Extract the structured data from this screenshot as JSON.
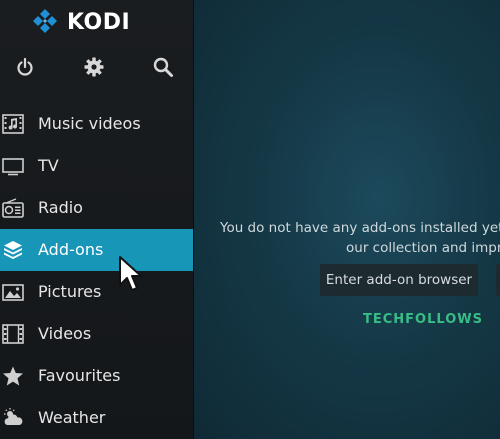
{
  "app": {
    "name": "KODI"
  },
  "top_icons": [
    {
      "icon": "power-icon"
    },
    {
      "icon": "gear-icon"
    },
    {
      "icon": "search-icon"
    }
  ],
  "menu": {
    "items": [
      {
        "label": "Music videos",
        "icon": "music-video-icon",
        "active": false
      },
      {
        "label": "TV",
        "icon": "tv-icon",
        "active": false
      },
      {
        "label": "Radio",
        "icon": "radio-icon",
        "active": false
      },
      {
        "label": "Add-ons",
        "icon": "addons-box-icon",
        "active": true
      },
      {
        "label": "Pictures",
        "icon": "pictures-icon",
        "active": false
      },
      {
        "label": "Videos",
        "icon": "film-icon",
        "active": false
      },
      {
        "label": "Favourites",
        "icon": "star-icon",
        "active": false
      },
      {
        "label": "Weather",
        "icon": "weather-icon",
        "active": false
      }
    ]
  },
  "main": {
    "message_line1": "You do not have any add-ons installed yet",
    "message_line2": "our collection and impr",
    "browser_button": "Enter add-on browser"
  },
  "watermark": "TECHFOLLOWS",
  "colors": {
    "accent": "#1796b8",
    "sidebar_bg": "#1a1d20",
    "main_bg": "#153846",
    "kodi_blue": "#1f8fd6",
    "watermark": "#3bcc8c"
  }
}
